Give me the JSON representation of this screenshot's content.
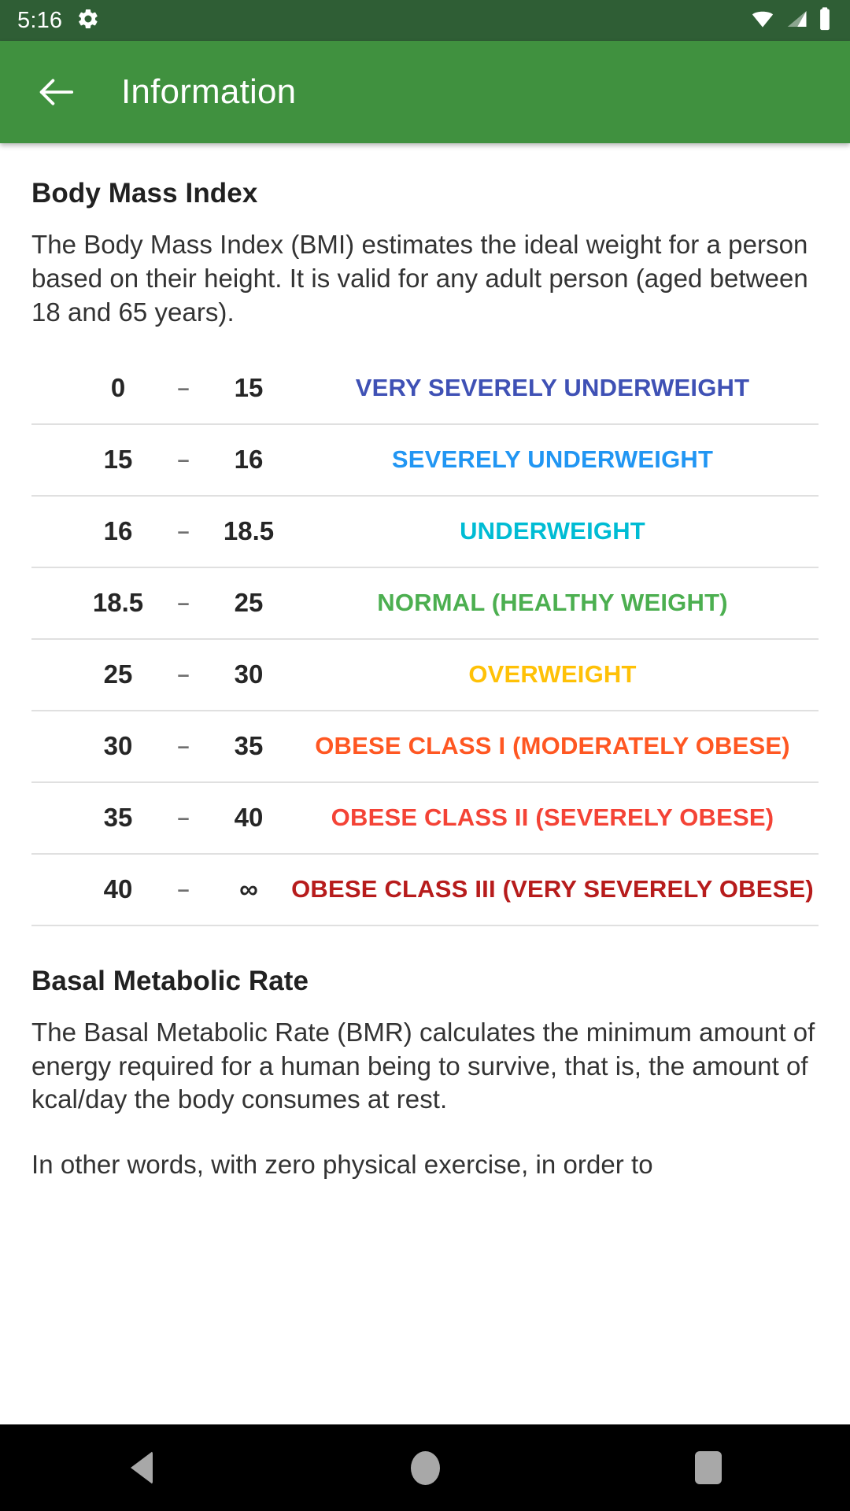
{
  "status_bar": {
    "time": "5:16",
    "icons": [
      "gear-icon",
      "wifi-icon",
      "cell-signal-icon",
      "battery-icon"
    ],
    "background": "#2f5e35"
  },
  "app_bar": {
    "back_label": "Back",
    "title": "Information",
    "background": "#40913f"
  },
  "sections": [
    {
      "title": "Body Mass Index",
      "paragraph": "The Body Mass Index (BMI) estimates the ideal weight for a person based on their height. It is valid for any adult person (aged between 18 and 65 years)."
    },
    {
      "title": "Basal Metabolic Rate",
      "paragraph": "The Basal Metabolic Rate (BMR) calculates the minimum amount of energy required for a human being to survive, that is, the amount of kcal/day the body consumes at rest.",
      "paragraph2": "In other words, with zero physical exercise, in order to"
    }
  ],
  "bmi_table": {
    "dash": "–",
    "rows": [
      {
        "min": "0",
        "max": "15",
        "label": "VERY SEVERELY UNDERWEIGHT",
        "color": "#3f51b5"
      },
      {
        "min": "15",
        "max": "16",
        "label": "SEVERELY UNDERWEIGHT",
        "color": "#2196f3"
      },
      {
        "min": "16",
        "max": "18.5",
        "label": "UNDERWEIGHT",
        "color": "#00bcd4"
      },
      {
        "min": "18.5",
        "max": "25",
        "label": "NORMAL (HEALTHY WEIGHT)",
        "color": "#4caf50"
      },
      {
        "min": "25",
        "max": "30",
        "label": "OVERWEIGHT",
        "color": "#ffc107"
      },
      {
        "min": "30",
        "max": "35",
        "label": "OBESE CLASS I (MODERATELY OBESE)",
        "color": "#ff5722"
      },
      {
        "min": "35",
        "max": "40",
        "label": "OBESE CLASS II (SEVERELY OBESE)",
        "color": "#f44336"
      },
      {
        "min": "40",
        "max": "∞",
        "label": "OBESE CLASS III (VERY SEVERELY OBESE)",
        "color": "#b71c1c"
      }
    ]
  },
  "nav_bar": {
    "back": "Back",
    "home": "Home",
    "recents": "Recents",
    "background": "#000000"
  }
}
